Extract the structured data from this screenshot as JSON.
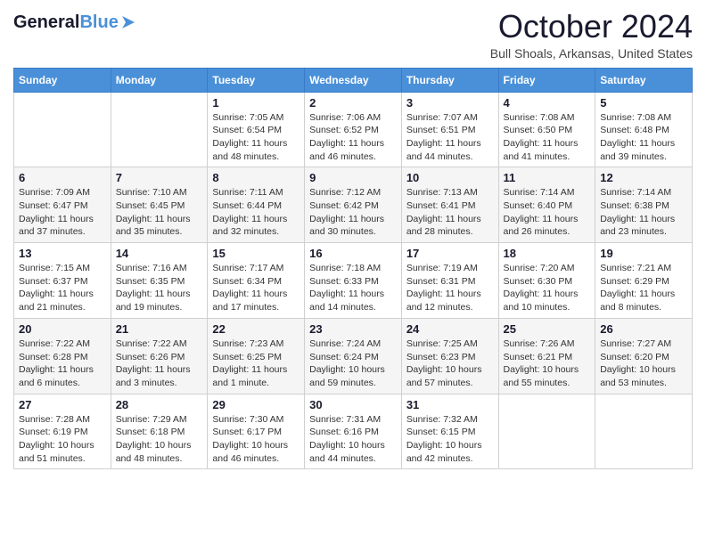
{
  "header": {
    "logo_general": "General",
    "logo_blue": "Blue",
    "month_title": "October 2024",
    "location": "Bull Shoals, Arkansas, United States"
  },
  "days_of_week": [
    "Sunday",
    "Monday",
    "Tuesday",
    "Wednesday",
    "Thursday",
    "Friday",
    "Saturday"
  ],
  "weeks": [
    [
      {
        "day": "",
        "sunrise": "",
        "sunset": "",
        "daylight": ""
      },
      {
        "day": "",
        "sunrise": "",
        "sunset": "",
        "daylight": ""
      },
      {
        "day": "1",
        "sunrise": "Sunrise: 7:05 AM",
        "sunset": "Sunset: 6:54 PM",
        "daylight": "Daylight: 11 hours and 48 minutes."
      },
      {
        "day": "2",
        "sunrise": "Sunrise: 7:06 AM",
        "sunset": "Sunset: 6:52 PM",
        "daylight": "Daylight: 11 hours and 46 minutes."
      },
      {
        "day": "3",
        "sunrise": "Sunrise: 7:07 AM",
        "sunset": "Sunset: 6:51 PM",
        "daylight": "Daylight: 11 hours and 44 minutes."
      },
      {
        "day": "4",
        "sunrise": "Sunrise: 7:08 AM",
        "sunset": "Sunset: 6:50 PM",
        "daylight": "Daylight: 11 hours and 41 minutes."
      },
      {
        "day": "5",
        "sunrise": "Sunrise: 7:08 AM",
        "sunset": "Sunset: 6:48 PM",
        "daylight": "Daylight: 11 hours and 39 minutes."
      }
    ],
    [
      {
        "day": "6",
        "sunrise": "Sunrise: 7:09 AM",
        "sunset": "Sunset: 6:47 PM",
        "daylight": "Daylight: 11 hours and 37 minutes."
      },
      {
        "day": "7",
        "sunrise": "Sunrise: 7:10 AM",
        "sunset": "Sunset: 6:45 PM",
        "daylight": "Daylight: 11 hours and 35 minutes."
      },
      {
        "day": "8",
        "sunrise": "Sunrise: 7:11 AM",
        "sunset": "Sunset: 6:44 PM",
        "daylight": "Daylight: 11 hours and 32 minutes."
      },
      {
        "day": "9",
        "sunrise": "Sunrise: 7:12 AM",
        "sunset": "Sunset: 6:42 PM",
        "daylight": "Daylight: 11 hours and 30 minutes."
      },
      {
        "day": "10",
        "sunrise": "Sunrise: 7:13 AM",
        "sunset": "Sunset: 6:41 PM",
        "daylight": "Daylight: 11 hours and 28 minutes."
      },
      {
        "day": "11",
        "sunrise": "Sunrise: 7:14 AM",
        "sunset": "Sunset: 6:40 PM",
        "daylight": "Daylight: 11 hours and 26 minutes."
      },
      {
        "day": "12",
        "sunrise": "Sunrise: 7:14 AM",
        "sunset": "Sunset: 6:38 PM",
        "daylight": "Daylight: 11 hours and 23 minutes."
      }
    ],
    [
      {
        "day": "13",
        "sunrise": "Sunrise: 7:15 AM",
        "sunset": "Sunset: 6:37 PM",
        "daylight": "Daylight: 11 hours and 21 minutes."
      },
      {
        "day": "14",
        "sunrise": "Sunrise: 7:16 AM",
        "sunset": "Sunset: 6:35 PM",
        "daylight": "Daylight: 11 hours and 19 minutes."
      },
      {
        "day": "15",
        "sunrise": "Sunrise: 7:17 AM",
        "sunset": "Sunset: 6:34 PM",
        "daylight": "Daylight: 11 hours and 17 minutes."
      },
      {
        "day": "16",
        "sunrise": "Sunrise: 7:18 AM",
        "sunset": "Sunset: 6:33 PM",
        "daylight": "Daylight: 11 hours and 14 minutes."
      },
      {
        "day": "17",
        "sunrise": "Sunrise: 7:19 AM",
        "sunset": "Sunset: 6:31 PM",
        "daylight": "Daylight: 11 hours and 12 minutes."
      },
      {
        "day": "18",
        "sunrise": "Sunrise: 7:20 AM",
        "sunset": "Sunset: 6:30 PM",
        "daylight": "Daylight: 11 hours and 10 minutes."
      },
      {
        "day": "19",
        "sunrise": "Sunrise: 7:21 AM",
        "sunset": "Sunset: 6:29 PM",
        "daylight": "Daylight: 11 hours and 8 minutes."
      }
    ],
    [
      {
        "day": "20",
        "sunrise": "Sunrise: 7:22 AM",
        "sunset": "Sunset: 6:28 PM",
        "daylight": "Daylight: 11 hours and 6 minutes."
      },
      {
        "day": "21",
        "sunrise": "Sunrise: 7:22 AM",
        "sunset": "Sunset: 6:26 PM",
        "daylight": "Daylight: 11 hours and 3 minutes."
      },
      {
        "day": "22",
        "sunrise": "Sunrise: 7:23 AM",
        "sunset": "Sunset: 6:25 PM",
        "daylight": "Daylight: 11 hours and 1 minute."
      },
      {
        "day": "23",
        "sunrise": "Sunrise: 7:24 AM",
        "sunset": "Sunset: 6:24 PM",
        "daylight": "Daylight: 10 hours and 59 minutes."
      },
      {
        "day": "24",
        "sunrise": "Sunrise: 7:25 AM",
        "sunset": "Sunset: 6:23 PM",
        "daylight": "Daylight: 10 hours and 57 minutes."
      },
      {
        "day": "25",
        "sunrise": "Sunrise: 7:26 AM",
        "sunset": "Sunset: 6:21 PM",
        "daylight": "Daylight: 10 hours and 55 minutes."
      },
      {
        "day": "26",
        "sunrise": "Sunrise: 7:27 AM",
        "sunset": "Sunset: 6:20 PM",
        "daylight": "Daylight: 10 hours and 53 minutes."
      }
    ],
    [
      {
        "day": "27",
        "sunrise": "Sunrise: 7:28 AM",
        "sunset": "Sunset: 6:19 PM",
        "daylight": "Daylight: 10 hours and 51 minutes."
      },
      {
        "day": "28",
        "sunrise": "Sunrise: 7:29 AM",
        "sunset": "Sunset: 6:18 PM",
        "daylight": "Daylight: 10 hours and 48 minutes."
      },
      {
        "day": "29",
        "sunrise": "Sunrise: 7:30 AM",
        "sunset": "Sunset: 6:17 PM",
        "daylight": "Daylight: 10 hours and 46 minutes."
      },
      {
        "day": "30",
        "sunrise": "Sunrise: 7:31 AM",
        "sunset": "Sunset: 6:16 PM",
        "daylight": "Daylight: 10 hours and 44 minutes."
      },
      {
        "day": "31",
        "sunrise": "Sunrise: 7:32 AM",
        "sunset": "Sunset: 6:15 PM",
        "daylight": "Daylight: 10 hours and 42 minutes."
      },
      {
        "day": "",
        "sunrise": "",
        "sunset": "",
        "daylight": ""
      },
      {
        "day": "",
        "sunrise": "",
        "sunset": "",
        "daylight": ""
      }
    ]
  ]
}
